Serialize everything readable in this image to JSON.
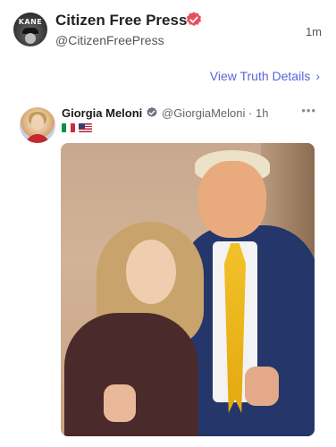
{
  "header": {
    "avatar_text": "KANE",
    "account_name": "Citizen Free Press",
    "handle": "@CitizenFreePress",
    "time": "1m",
    "verified_icon": "verified-badge-icon",
    "verified_color": "#e8505b"
  },
  "link": {
    "label": "View Truth Details",
    "chevron": "›",
    "color": "#5865d9"
  },
  "post": {
    "author_name": "Giorgia Meloni",
    "author_handle": "@GiorgiaMeloni",
    "age": "· 1h",
    "more": "•••",
    "flags": [
      "italy-flag-icon",
      "usa-flag-icon"
    ],
    "verified_color": "#6b7280"
  }
}
